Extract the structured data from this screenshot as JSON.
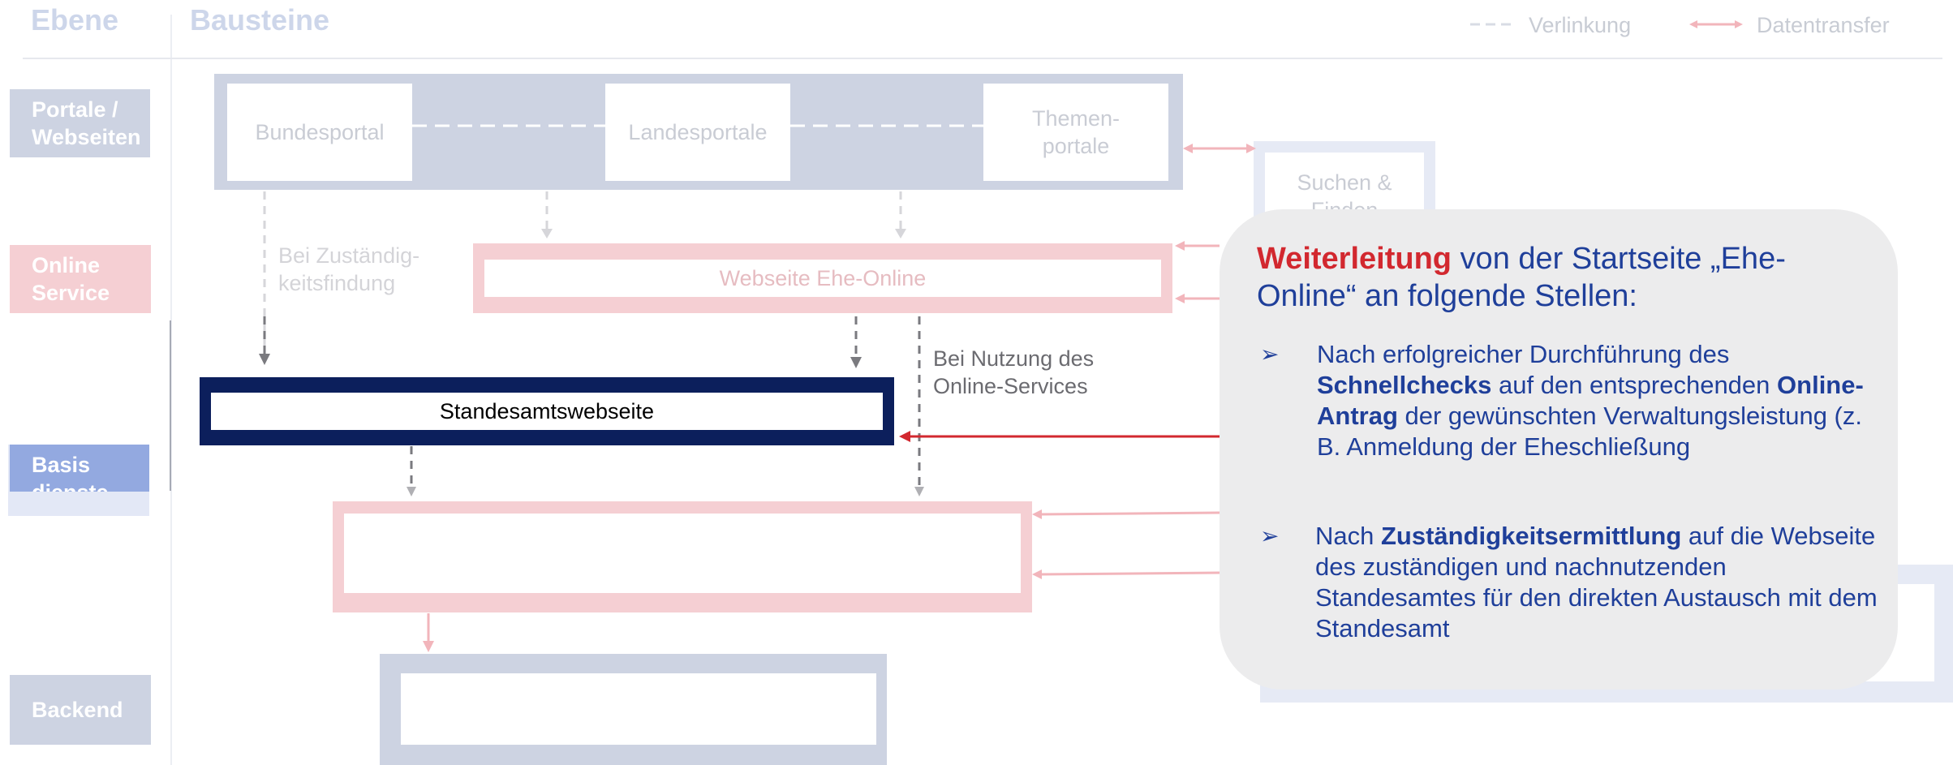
{
  "header": {
    "level_label": "Ebene",
    "blocks_label": "Bausteine"
  },
  "legend": {
    "link_label": "Verlinkung",
    "transfer_label": "Datentransfer"
  },
  "levels": {
    "portale": "Portale / Webseiten",
    "online": "Online Service",
    "basis": "Basis dienste",
    "backend": "Backend"
  },
  "portals": {
    "bund": "Bundesportal",
    "land": "Landesportale",
    "themen": "Themen- portale"
  },
  "suchen": "Suchen & Finden",
  "website_ehe": "Webseite Ehe-Online",
  "standesamt": "Standesamtswebseite",
  "notes": {
    "zustaendig": "Bei Zuständig- keitsfindung",
    "nutzung": "Bei Nutzung des Online-Services"
  },
  "callout": {
    "title_bold": "Weiterleitung",
    "title_rest": " von der Startseite „Ehe-Online“ an folgende Stellen:",
    "bullet1": [
      {
        "t": "Nach erfolgreicher Durchführung des ",
        "b": false
      },
      {
        "t": "Schnellchecks",
        "b": true
      },
      {
        "t": " auf den entsprechenden ",
        "b": false
      },
      {
        "t": "Online-Antrag",
        "b": true
      },
      {
        "t": " der gewünschten Verwaltungsleistung (z. B. Anmeldung der Eheschließung",
        "b": false
      }
    ],
    "bullet2": [
      {
        "t": "Nach ",
        "b": false
      },
      {
        "t": "Zuständigkeitsermittlung",
        "b": true
      },
      {
        "t": " auf die Webseite des zuständigen und nachnutzenden Standesamtes für den direkten Austausch mit dem Standesamt",
        "b": false
      }
    ]
  },
  "colors": {
    "navy": "#0c1f5c",
    "accent_red": "#d2282f",
    "callout_blue": "#1f3f9a",
    "faint_blue": "#cdd3e2",
    "faint_pink": "#f5cfd3"
  }
}
